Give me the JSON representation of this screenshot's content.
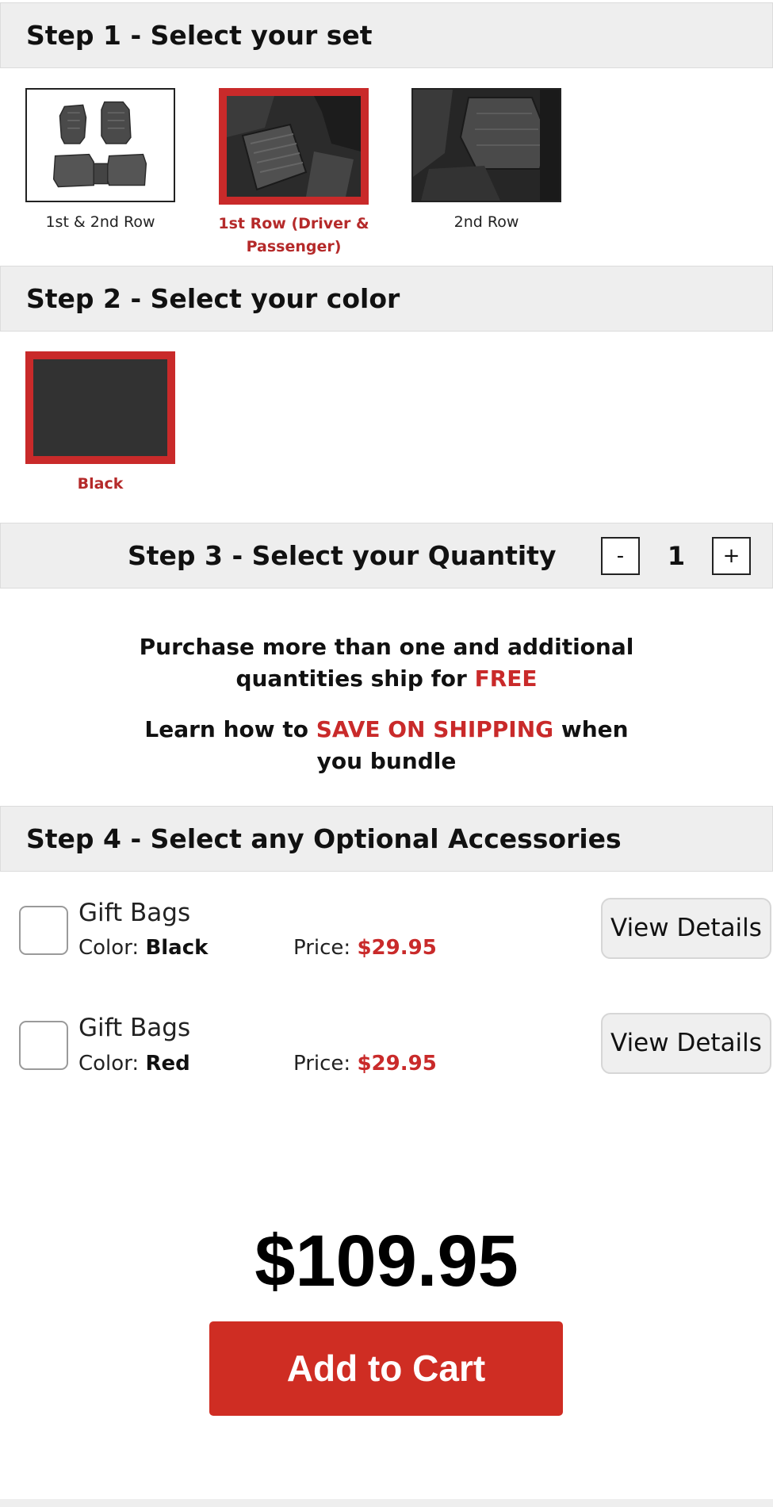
{
  "step1": {
    "title": "Step 1 - Select your set",
    "options": [
      {
        "label": "1st & 2nd Row",
        "selected": false
      },
      {
        "label": "1st Row (Driver & Passenger)",
        "selected": true
      },
      {
        "label": "2nd Row",
        "selected": false
      }
    ]
  },
  "step2": {
    "title": "Step 2 - Select your color",
    "options": [
      {
        "label": "Black",
        "selected": true
      }
    ]
  },
  "step3": {
    "title": "Step 3 - Select your Quantity",
    "decrement": "-",
    "quantity": "1",
    "increment": "+"
  },
  "promo": {
    "line1_prefix": "Purchase more than one and additional quantities ship for ",
    "line1_highlight": "FREE",
    "line2_prefix": "Learn how to ",
    "line2_highlight": "SAVE ON SHIPPING",
    "line2_suffix": " when you bundle"
  },
  "step4": {
    "title": "Step 4 - Select any Optional Accessories",
    "items": [
      {
        "name": "Gift Bags",
        "color_label": "Color:",
        "color": "Black",
        "price_label": "Price:",
        "price": "$29.95",
        "button": "View Details",
        "checked": false
      },
      {
        "name": "Gift Bags",
        "color_label": "Color:",
        "color": "Red",
        "price_label": "Price:",
        "price": "$29.95",
        "button": "View Details",
        "checked": false
      }
    ]
  },
  "total": "$109.95",
  "add_to_cart": "Add to Cart",
  "colors": {
    "accent": "#c92a2a",
    "cart_button": "#cf2d23",
    "band": "#eeeeee"
  }
}
